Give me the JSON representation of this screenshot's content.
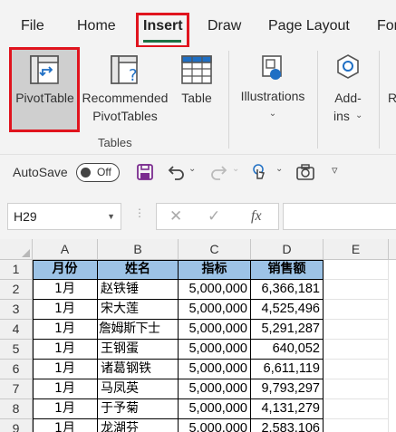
{
  "menu": {
    "tabs": [
      "File",
      "Home",
      "Insert",
      "Draw",
      "Page Layout",
      "For"
    ],
    "active_tab": "Insert"
  },
  "ribbon": {
    "pivot_table": "PivotTable",
    "recommended_line1": "Recommended",
    "recommended_line2": "PivotTables",
    "table": "Table",
    "illustrations": "Illustrations",
    "addins_line1": "Add-",
    "addins_line2": "ins",
    "group_tables": "Tables",
    "cut_off": "R"
  },
  "qat": {
    "autosave_label": "AutoSave",
    "autosave_state": "Off"
  },
  "formula_bar": {
    "name_box": "H29",
    "fx": "fx",
    "formula": ""
  },
  "grid": {
    "columns": [
      "A",
      "B",
      "C",
      "D",
      "E"
    ],
    "rows": [
      "1",
      "2",
      "3",
      "4",
      "5",
      "6",
      "7",
      "8",
      "9"
    ],
    "header": [
      "月份",
      "姓名",
      "指标",
      "销售额"
    ],
    "data": [
      [
        "1月",
        "赵铁锤",
        "5,000,000",
        "6,366,181"
      ],
      [
        "1月",
        "宋大莲",
        "5,000,000",
        "4,525,496"
      ],
      [
        "1月",
        "詹姆斯下士",
        "5,000,000",
        "5,291,287"
      ],
      [
        "1月",
        "王钢蛋",
        "5,000,000",
        "640,052"
      ],
      [
        "1月",
        "诸葛钢铁",
        "5,000,000",
        "6,611,119"
      ],
      [
        "1月",
        "马凤英",
        "5,000,000",
        "9,793,297"
      ],
      [
        "1月",
        "于予菊",
        "5,000,000",
        "4,131,279"
      ],
      [
        "1月",
        "龙湖芬",
        "5,000,000",
        "2,583,106"
      ]
    ]
  },
  "colors": {
    "header_fill": "#9dc3e6",
    "active_tab_underline": "#1e7145",
    "highlight_box": "#e0141e",
    "save_icon": "#7b2c8f"
  }
}
